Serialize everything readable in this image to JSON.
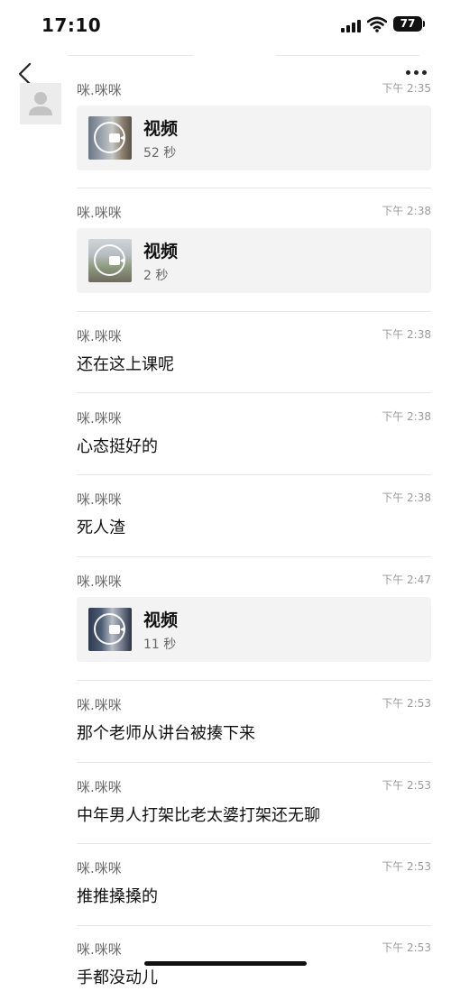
{
  "status": {
    "time": "17:10",
    "battery": "77"
  },
  "messages": [
    {
      "sender": "咪.咪咪",
      "time": "下午 2:35",
      "type": "video",
      "title": "视频",
      "duration": "52 秒"
    },
    {
      "sender": "咪.咪咪",
      "time": "下午 2:38",
      "type": "video",
      "title": "视频",
      "duration": "2 秒"
    },
    {
      "sender": "咪.咪咪",
      "time": "下午 2:38",
      "type": "text",
      "text": "还在这上课呢"
    },
    {
      "sender": "咪.咪咪",
      "time": "下午 2:38",
      "type": "text",
      "text": "心态挺好的"
    },
    {
      "sender": "咪.咪咪",
      "time": "下午 2:38",
      "type": "text",
      "text": "死人渣"
    },
    {
      "sender": "咪.咪咪",
      "time": "下午 2:47",
      "type": "video",
      "title": "视频",
      "duration": "11 秒"
    },
    {
      "sender": "咪.咪咪",
      "time": "下午 2:53",
      "type": "text",
      "text": "那个老师从讲台被揍下来"
    },
    {
      "sender": "咪.咪咪",
      "time": "下午 2:53",
      "type": "text",
      "text": "中年男人打架比老太婆打架还无聊"
    },
    {
      "sender": "咪.咪咪",
      "time": "下午 2:53",
      "type": "text",
      "text": "推推搡搡的"
    },
    {
      "sender": "咪.咪咪",
      "time": "下午 2:53",
      "type": "text",
      "text": "手都没动儿"
    }
  ]
}
